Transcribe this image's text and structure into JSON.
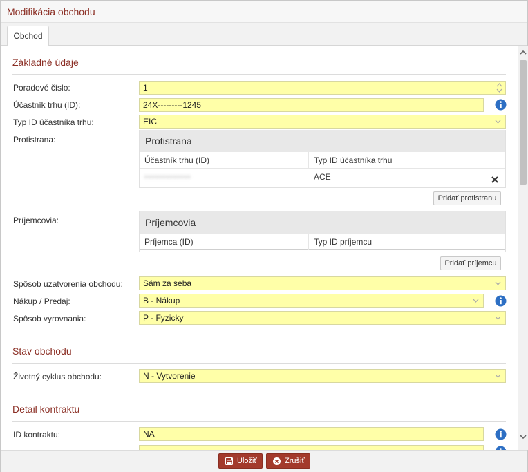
{
  "window": {
    "title": "Modifikácia obchodu"
  },
  "tabs": [
    {
      "label": "Obchod"
    }
  ],
  "sections": {
    "basic": {
      "title": "Základné údaje"
    },
    "state": {
      "title": "Stav obchodu"
    },
    "detail": {
      "title": "Detail kontraktu"
    }
  },
  "fields": {
    "poradove_cislo": {
      "label": "Poradové číslo:",
      "value": "1"
    },
    "ucastnik_trhu": {
      "label": "Účastník trhu (ID):",
      "value": "24X---------1245"
    },
    "typ_id_ucastnika": {
      "label": "Typ ID účastníka trhu:",
      "value": "EIC"
    },
    "protistrana": {
      "label": "Protistrana:"
    },
    "prijemcovia": {
      "label": "Príjemcovia:"
    },
    "sposob_uzatvorenia": {
      "label": "Spôsob uzatvorenia obchodu:",
      "value": "Sám za seba"
    },
    "nakup_predaj": {
      "label": "Nákup / Predaj:",
      "value": "B - Nákup"
    },
    "sposob_vyrovnania": {
      "label": "Spôsob vyrovnania:",
      "value": "P - Fyzicky"
    },
    "zivotny_cyklus": {
      "label": "Životný cyklus obchodu:",
      "value": "N - Vytvorenie"
    },
    "id_kontraktu": {
      "label": "ID kontraktu:",
      "value": "NA"
    }
  },
  "protistrana_panel": {
    "title": "Protistrana",
    "columns": [
      "Účastník trhu (ID)",
      "Typ ID účastníka trhu"
    ],
    "rows": [
      {
        "ucastnik": "•••••••••••••",
        "typ": "ACE"
      }
    ],
    "add_button": "Pridať protistranu"
  },
  "prijemcovia_panel": {
    "title": "Príjemcovia",
    "columns": [
      "Príjemca (ID)",
      "Typ ID príjemcu"
    ],
    "add_button": "Pridať príjemcu"
  },
  "footer": {
    "save_label": "Uložiť",
    "cancel_label": "Zrušiť"
  },
  "colors": {
    "accent": "#8b2e24",
    "field_bg": "#ffffa8",
    "info": "#2d6fc4",
    "button_red": "#a33a2c"
  },
  "icons": [
    "info-icon",
    "delete-x-icon",
    "save-icon",
    "cancel-icon",
    "chevron-down-icon",
    "spinner-icon"
  ]
}
